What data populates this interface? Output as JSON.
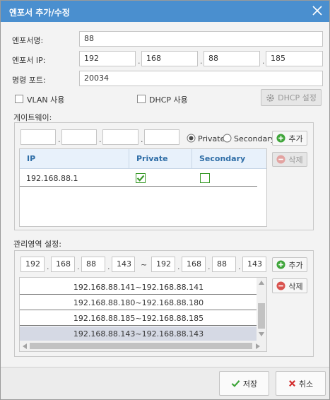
{
  "dialog": {
    "title": "엔포서 추가/수정"
  },
  "form": {
    "name_label": "엔포서명:",
    "name_value": "88",
    "ip_label": "엔포서 IP:",
    "ip_octets": [
      "192",
      "168",
      "88",
      "185"
    ],
    "port_label": "명령 포트:",
    "port_value": "20034",
    "vlan_label": "VLAN 사용",
    "dhcp_label": "DHCP 사용",
    "dhcp_settings_button": "DHCP 설정"
  },
  "gateway": {
    "section_label": "게이트웨이:",
    "ip_octets": [
      "",
      "",
      "",
      ""
    ],
    "radio_private": "Private",
    "radio_secondary": "Secondary",
    "add_button": "추가",
    "delete_button": "삭제",
    "columns": [
      "IP",
      "Private",
      "Secondary"
    ],
    "rows": [
      {
        "ip": "192.168.88.1",
        "private": true,
        "secondary": false
      }
    ]
  },
  "management": {
    "section_label": "관리영역 설정:",
    "start_octets": [
      "192",
      "168",
      "88",
      "143"
    ],
    "range_sep": "~",
    "end_octets": [
      "192",
      "168",
      "88",
      "143"
    ],
    "add_button": "추가",
    "delete_button": "삭제",
    "ranges": [
      "192.168.88.141~192.168.88.141",
      "192.168.88.180~192.168.88.180",
      "192.168.88.185~192.168.88.185",
      "192.168.88.143~192.168.88.143"
    ],
    "selected_index": 3
  },
  "footer": {
    "save_button": "저장",
    "cancel_button": "취소"
  },
  "colors": {
    "titlebar": "#4a8fcf",
    "check_green": "#3a9a2a",
    "add_green": "#3fa53a",
    "delete_red": "#d9534f",
    "cancel_red": "#d32f2f"
  }
}
